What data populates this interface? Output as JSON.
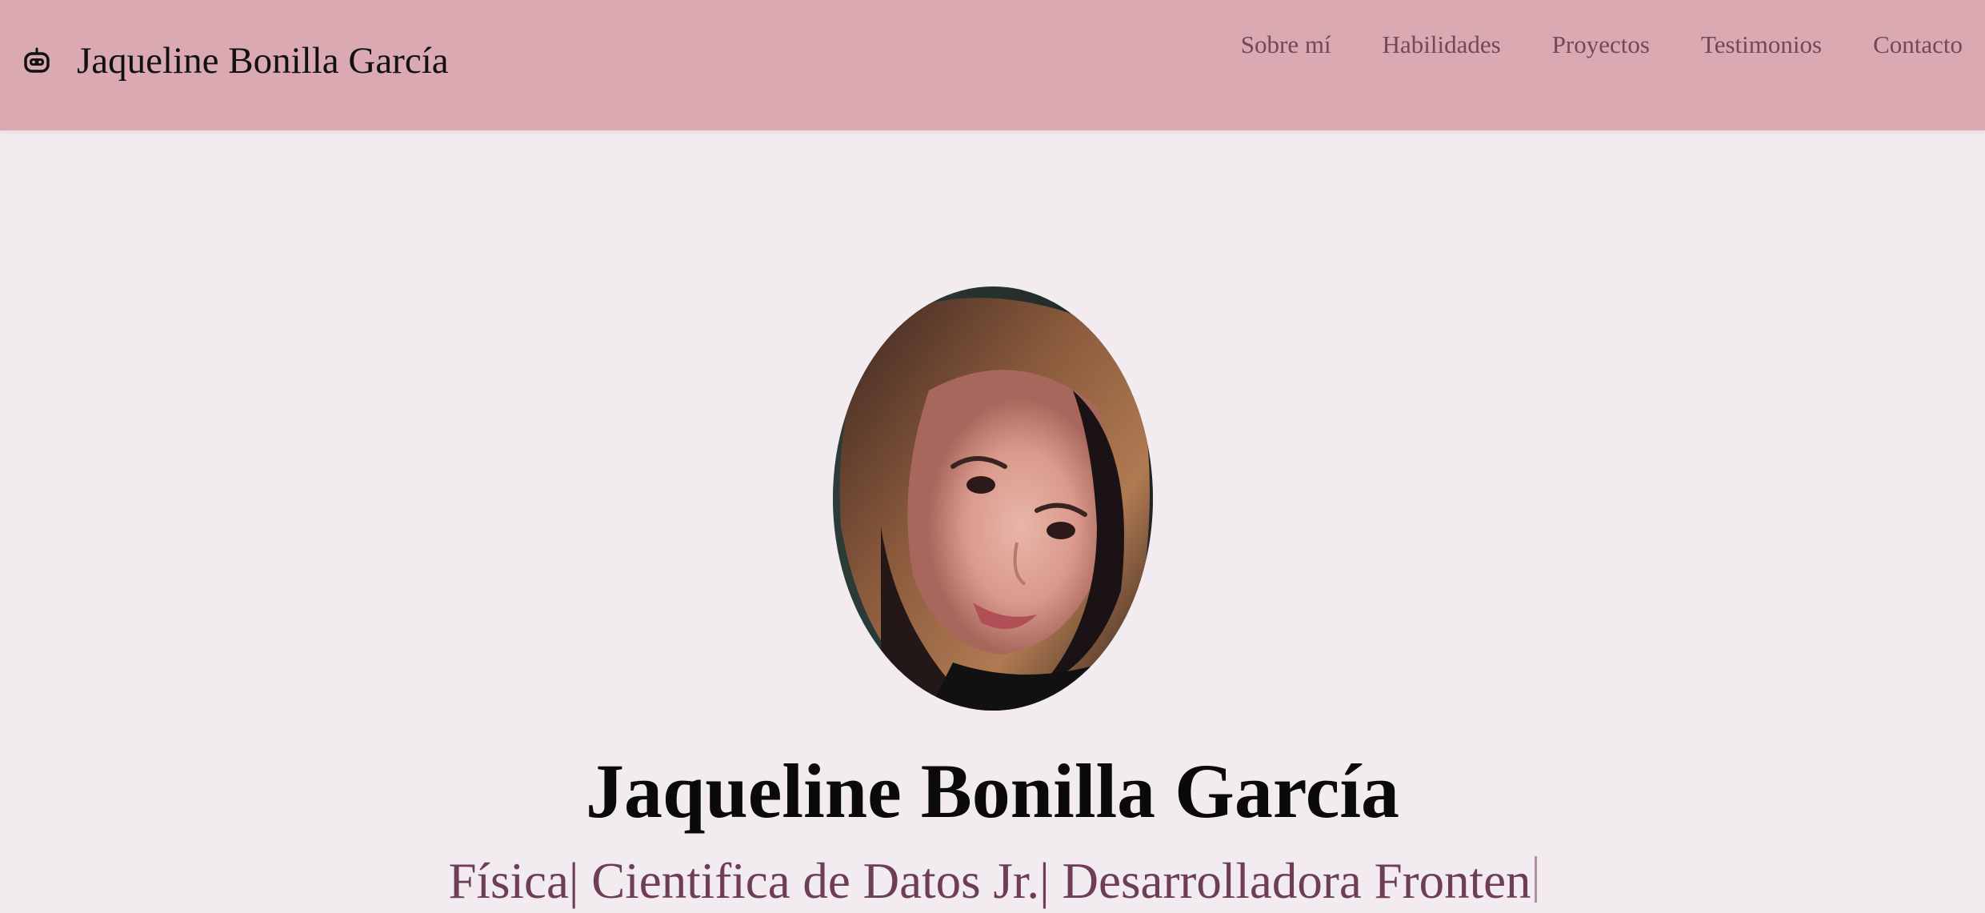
{
  "header": {
    "brand_icon": "robot-icon",
    "brand_name": "Jaqueline Bonilla García",
    "nav": [
      {
        "label": "Sobre mí"
      },
      {
        "label": "Habilidades"
      },
      {
        "label": "Proyectos"
      },
      {
        "label": "Testimonios"
      },
      {
        "label": "Contacto"
      }
    ]
  },
  "hero": {
    "photo_alt": "profile-photo",
    "name": "Jaqueline Bonilla García",
    "roles_text": "Física| Cientifica de Datos Jr.| Desarrolladora Fronten"
  },
  "colors": {
    "navbar_bg": "#dba9b2",
    "page_bg": "#f2ecf0",
    "nav_link": "#6e4a5b",
    "roles_text": "#6e3e56",
    "name_text": "#0a0a0a"
  }
}
